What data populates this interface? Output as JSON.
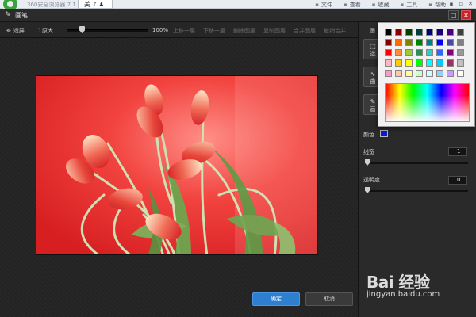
{
  "browser": {
    "title": "360安全浏览器 7.1",
    "tab_label": "美",
    "menu": [
      "文件",
      "查看",
      "收藏",
      "工具",
      "帮助"
    ],
    "window_controls": [
      "▪",
      "▫",
      "✕"
    ]
  },
  "dialog": {
    "title": "画笔",
    "maximize_icon": "□",
    "close_icon": "✕"
  },
  "toolbar": {
    "fit_label": "适屏",
    "original_label": "原大",
    "zoom_value": "100%",
    "zoom_level": 1.0,
    "layer_buttons": [
      "上移一层",
      "下移一层",
      "删除图层",
      "复制图层",
      "合并图层",
      "撤销合并"
    ]
  },
  "canvas": {
    "image_subject": "red tulips on red background"
  },
  "actions": {
    "ok_label": "确定",
    "cancel_label": "取消"
  },
  "right_panel": {
    "brush_label": "画",
    "tool_buttons": [
      {
        "label": "选",
        "icon": "select-icon"
      },
      {
        "label": "曲",
        "icon": "curve-icon"
      },
      {
        "label": "画",
        "icon": "pen-icon"
      }
    ],
    "color_label": "颜色",
    "current_color": "#0a1ad6",
    "line_width_label": "线宽",
    "line_width_value": "1",
    "opacity_label": "透明度",
    "opacity_value": "0"
  },
  "color_picker": {
    "swatches": [
      "#000000",
      "#8b0000",
      "#004000",
      "#003f3f",
      "#000080",
      "#1a007a",
      "#4b0082",
      "#404040",
      "#800000",
      "#ff6a00",
      "#808000",
      "#008000",
      "#008080",
      "#0000ff",
      "#4a4aa5",
      "#808080",
      "#ff0000",
      "#ff8c3c",
      "#9acd32",
      "#2e8b57",
      "#33cccc",
      "#3366ff",
      "#800080",
      "#999999",
      "#ffb6c1",
      "#ffcc00",
      "#ffff00",
      "#00ff00",
      "#00ffff",
      "#00ccff",
      "#993366",
      "#c0c0c0",
      "#ff99cc",
      "#ffcc99",
      "#ffff99",
      "#ccffcc",
      "#ccffff",
      "#99ccff",
      "#cc99ff",
      "#ffffff"
    ]
  },
  "watermark": {
    "logo": "Bai 经验",
    "url": "jingyan.baidu.com"
  }
}
